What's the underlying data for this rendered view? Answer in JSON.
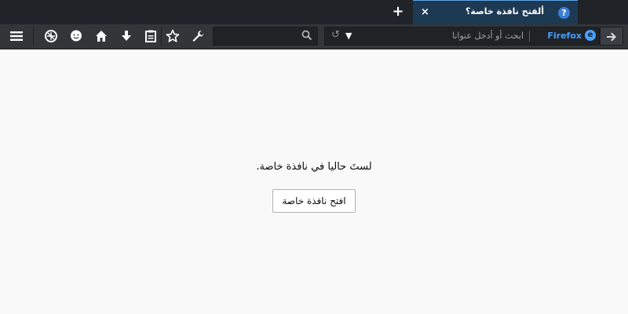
{
  "tabs": [
    {
      "title": "ألفتح نافذة خاصة؟",
      "favicon": "question-icon",
      "active": true,
      "close_glyph": "×"
    }
  ],
  "new_tab_glyph": "+",
  "toolbar": {
    "left_icons": [
      {
        "name": "menu-icon",
        "glyph": "☰"
      },
      {
        "name": "private-mask-icon",
        "glyph": "◍"
      },
      {
        "name": "chat-icon",
        "glyph": "☻"
      },
      {
        "name": "home-icon",
        "glyph": "⌂"
      },
      {
        "name": "download-icon",
        "glyph": "⬇"
      },
      {
        "name": "reader-icon",
        "glyph": "▤"
      },
      {
        "name": "bookmark-star-icon",
        "glyph": "☆"
      },
      {
        "name": "wrench-icon",
        "glyph": "🔧"
      }
    ],
    "search_icon": "⚲",
    "url_bar": {
      "placeholder": "ابحث أو أدخل عنوانا",
      "identity_label": "Firefox",
      "dropdown_glyph": "▼",
      "reload_glyph": "↺"
    },
    "forward_glyph": "➔"
  },
  "content": {
    "message": "لستَ حاليا في نافذة خاصة.",
    "button_label": "افتح نافذة خاصة"
  },
  "colors": {
    "tabstrip_bg": "#202328",
    "active_tab_bg": "#1d3954",
    "toolbar_bg": "#323639",
    "page_bg": "#f9f9fa",
    "identity_accent": "#45a1ff"
  }
}
